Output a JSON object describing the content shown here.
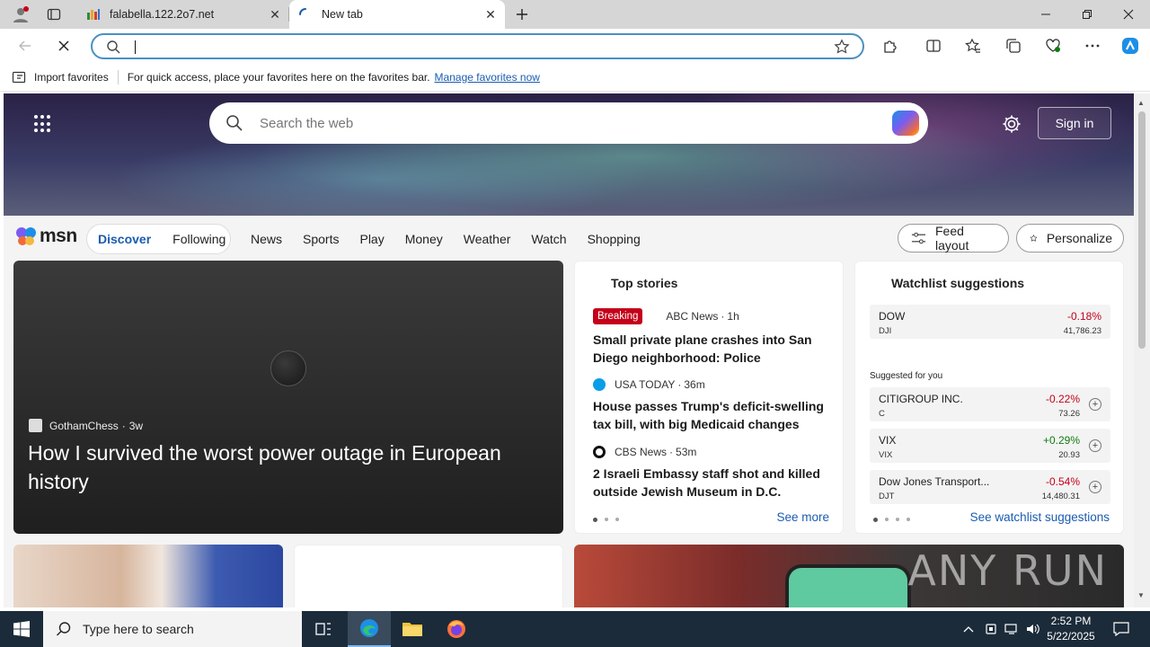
{
  "browser": {
    "tabs": [
      {
        "title": "falabella.122.2o7.net",
        "active": false
      },
      {
        "title": "New tab",
        "active": true
      }
    ],
    "favorites_bar": {
      "import_label": "Import favorites",
      "hint": "For quick access, place your favorites here on the favorites bar.",
      "manage_link": "Manage favorites now"
    }
  },
  "msn": {
    "search_placeholder": "Search the web",
    "sign_in": "Sign in",
    "logo_text": "msn",
    "primary_tabs": [
      {
        "label": "Discover",
        "active": true
      },
      {
        "label": "Following",
        "active": false
      }
    ],
    "nav": [
      "News",
      "Sports",
      "Play",
      "Money",
      "Weather",
      "Watch",
      "Shopping"
    ],
    "feed_layout": "Feed layout",
    "personalize": "Personalize",
    "video": {
      "source": "GothamChess",
      "age": "3w",
      "headline": "How I survived the worst power outage in European history"
    },
    "top_stories": {
      "title": "Top stories",
      "see_more": "See more",
      "items": [
        {
          "badge": "Breaking",
          "source": "ABC News",
          "age": "1h",
          "headline": "Small private plane crashes into San Diego neighborhood: Police"
        },
        {
          "source": "USA TODAY",
          "age": "36m",
          "headline": "House passes Trump's deficit-swelling tax bill, with big Medicaid changes"
        },
        {
          "source": "CBS News",
          "age": "53m",
          "headline": "2 Israeli Embassy staff shot and killed outside Jewish Museum in D.C."
        }
      ]
    },
    "watchlist": {
      "title": "Watchlist suggestions",
      "suggested_label": "Suggested for you",
      "see_link": "See watchlist suggestions",
      "quotes": [
        {
          "name": "DOW",
          "symbol": "DJI",
          "change": "-0.18%",
          "price": "41,786.23",
          "direction": "down"
        },
        {
          "name": "CITIGROUP INC.",
          "symbol": "C",
          "change": "-0.22%",
          "price": "73.26",
          "direction": "down"
        },
        {
          "name": "VIX",
          "symbol": "VIX",
          "change": "+0.29%",
          "price": "20.93",
          "direction": "up"
        },
        {
          "name": "Dow Jones Transport...",
          "symbol": "DJT",
          "change": "-0.54%",
          "price": "14,480.31",
          "direction": "down"
        }
      ]
    },
    "watermark": "ANY RUN"
  },
  "taskbar": {
    "search_placeholder": "Type here to search",
    "time": "2:52 PM",
    "date": "5/22/2025"
  },
  "colors": {
    "accent": "#1a5cb0",
    "breaking": "#c4001a",
    "negative": "#c4001a",
    "positive": "#107c10",
    "taskbar": "#1c2b3a"
  }
}
